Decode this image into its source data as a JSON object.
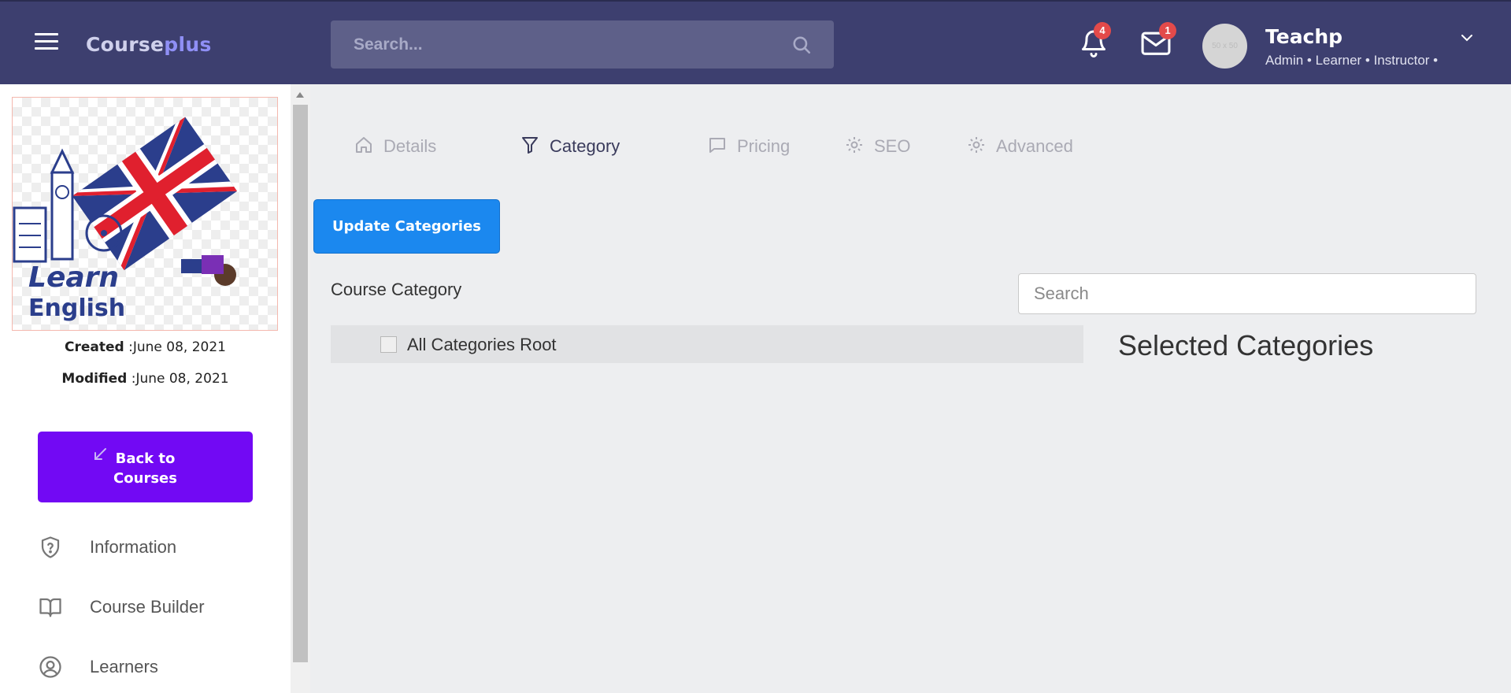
{
  "header": {
    "logo_main": "Course",
    "logo_accent": "plus",
    "search_placeholder": "Search...",
    "notifications_count": "4",
    "messages_count": "1",
    "avatar_placeholder": "50 x 50",
    "user_name": "Teachp",
    "user_roles": "Admin • Learner • Instructor •"
  },
  "sidebar": {
    "course_image_text_line1": "Learn",
    "course_image_text_line2": "English",
    "created_label": "Created",
    "created_value": " :June 08, 2021",
    "modified_label": "Modified",
    "modified_value": " :June 08, 2021",
    "back_button": "Back to Courses",
    "nav": [
      {
        "label": "Information",
        "icon": "shield-question-icon"
      },
      {
        "label": "Course Builder",
        "icon": "book-open-icon"
      },
      {
        "label": "Learners",
        "icon": "user-circle-icon"
      }
    ]
  },
  "tabs": [
    {
      "label": "Details",
      "icon": "home-icon",
      "active": false
    },
    {
      "label": "Category",
      "icon": "filter-icon",
      "active": true
    },
    {
      "label": "Pricing",
      "icon": "chat-icon",
      "active": false
    },
    {
      "label": "SEO",
      "icon": "gear-icon",
      "active": false
    },
    {
      "label": "Advanced",
      "icon": "gear-icon",
      "active": false
    }
  ],
  "main": {
    "update_button": "Update Categories",
    "section_title": "Course Category",
    "category_search_placeholder": "Search",
    "tree_root_label": "All Categories Root",
    "selected_title": "Selected Categories"
  },
  "colors": {
    "header_bg": "#3d3f6f",
    "primary_button": "#1b88ef",
    "back_button": "#7209f4",
    "badge": "#e34a4a"
  }
}
